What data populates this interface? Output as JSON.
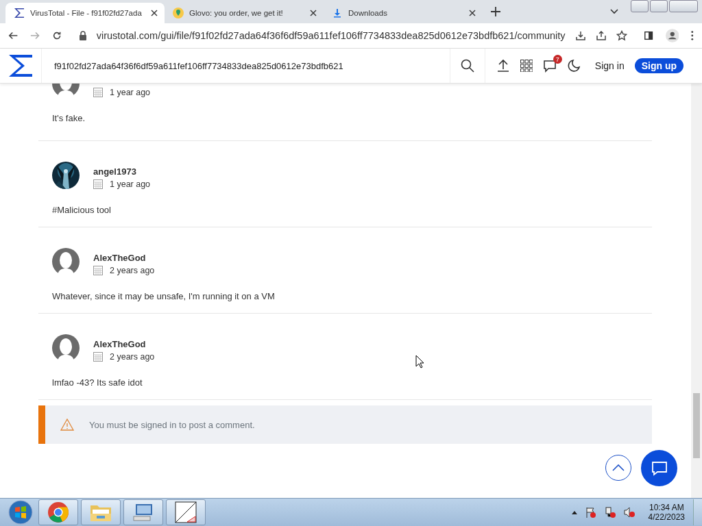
{
  "browser": {
    "tabs": [
      {
        "kind": "sigma",
        "title": "VirusTotal - File - f91f02fd27ada",
        "selected": true
      },
      {
        "kind": "pin",
        "title": "Glovo: you order, we get it!",
        "selected": false
      },
      {
        "kind": "download",
        "title": "Downloads",
        "selected": false
      }
    ],
    "address": "virustotal.com/gui/file/f91f02fd27ada64f36f6df59a611fef106ff7734833dea825d0612e73bdfb621/community"
  },
  "header": {
    "search": "f91f02fd27ada64f36f6df59a611fef106ff7734833dea825d0612e73bdfb621",
    "notifications": "7",
    "sign_in": "Sign in",
    "sign_up": "Sign up"
  },
  "comments": [
    {
      "kind": "silhouette",
      "date": "1 year ago",
      "text": "It's fake."
    },
    {
      "kind": "picture",
      "user": "angel1973",
      "date": "1 year ago",
      "text": "#Malicious tool"
    },
    {
      "kind": "silhouette",
      "user": "AlexTheGod",
      "date": "2 years ago",
      "text": "Whatever, since it may be unsafe, I'm running it on a VM"
    },
    {
      "kind": "silhouette",
      "user": "AlexTheGod",
      "date": "2 years ago",
      "text": "lmfao -43? Its safe idot"
    }
  ],
  "notice": "You must be signed in to post a comment.",
  "taskbar": {
    "apps": [
      {
        "kind": "chrome"
      },
      {
        "kind": "folder"
      },
      {
        "kind": "computer"
      },
      {
        "kind": "app"
      }
    ],
    "time": "10:34 AM",
    "date": "4/22/2023"
  }
}
